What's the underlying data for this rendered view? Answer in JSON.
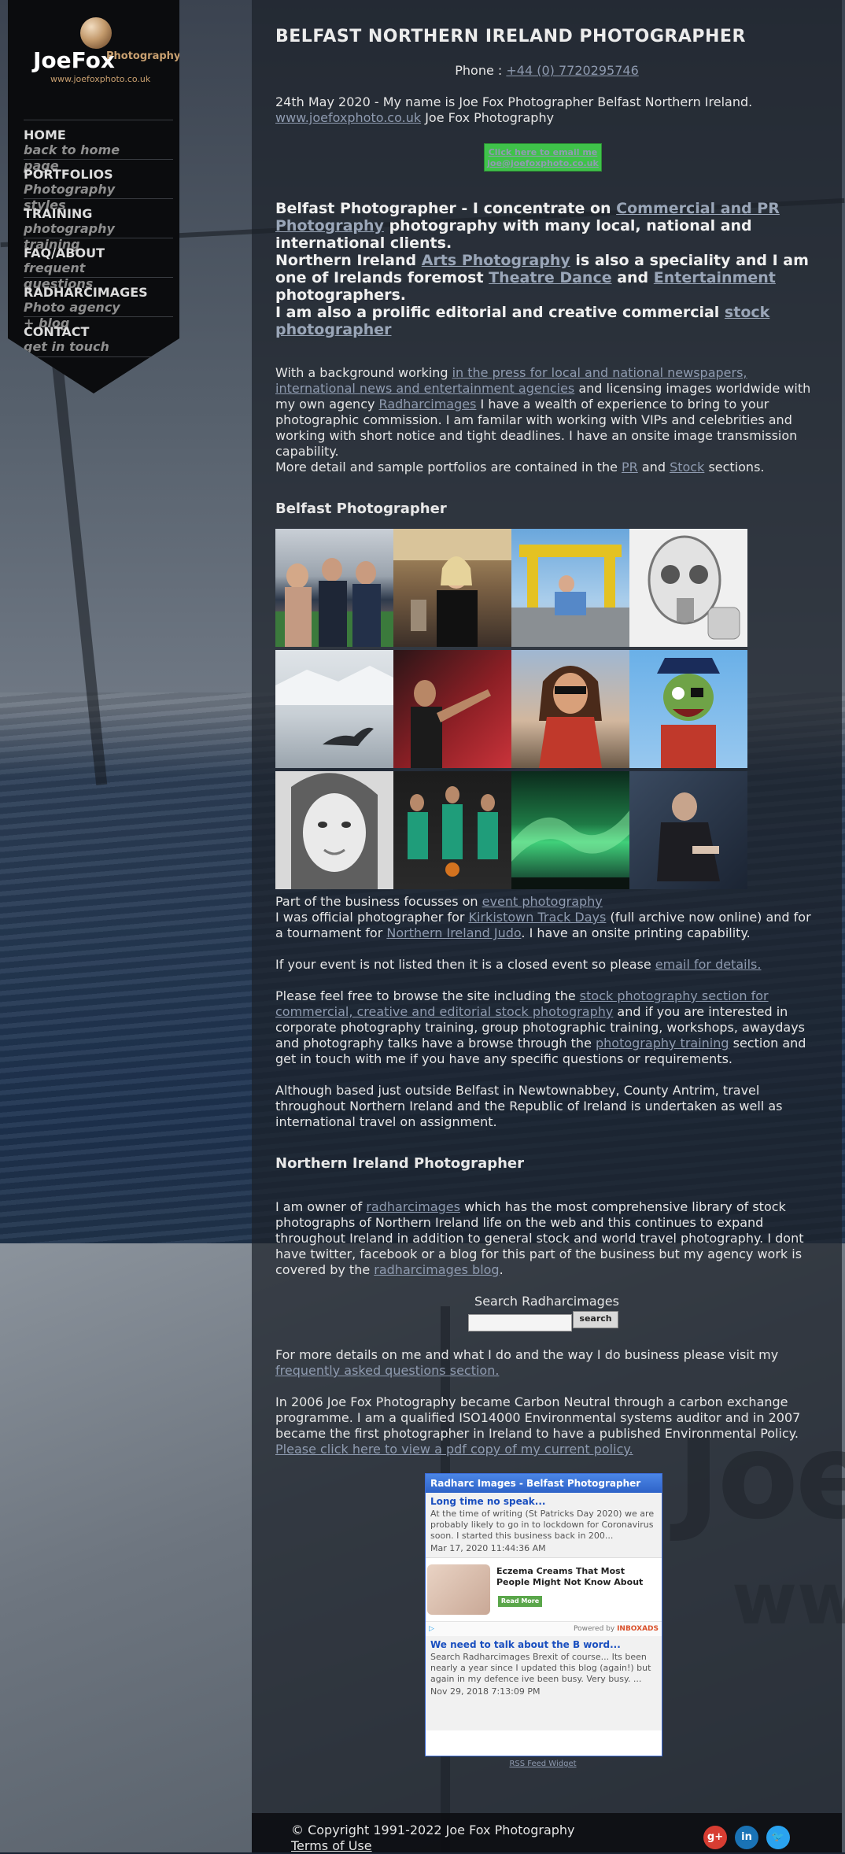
{
  "brand": {
    "logo_name": "JoeFox",
    "logo_sub": "Photography",
    "logo_url": "www.joefoxphoto.co.uk"
  },
  "nav": [
    {
      "label": "HOME",
      "sub": "back to home page"
    },
    {
      "label": "PORTFOLIOS",
      "sub": "Photography styles"
    },
    {
      "label": "TRAINING",
      "sub": "photography training"
    },
    {
      "label": "FAQ/ABOUT",
      "sub": "frequent questions"
    },
    {
      "label": "RADHARCIMAGES",
      "sub": "Photo agency + blog"
    },
    {
      "label": "CONTACT",
      "sub": "get in touch"
    }
  ],
  "header": {
    "title": "BELFAST NORTHERN IRELAND PHOTOGRAPHER",
    "phone_label": "Phone : ",
    "phone_number": "+44 (0) 7720295746"
  },
  "intro": {
    "date_text": "24th May 2020 - My name is Joe Fox Photographer Belfast Northern Ireland.",
    "site_link": "www.joefoxphoto.co.uk",
    "site_suffix": " Joe Fox Photography",
    "email_button_line1": "Click here to email me",
    "email_button_line2": "joe@joefoxphoto.co.uk"
  },
  "highlight": {
    "t1": "Belfast Photographer - I concentrate on ",
    "l1": "Commercial and PR Photography",
    "t2": " photography with many local, national and international clients.",
    "t3": "Northern Ireland ",
    "l2": "Arts Photography",
    "t4": " is also a speciality and I am one of Irelands foremost ",
    "l3": "Theatre Dance",
    "t5": " and ",
    "l4": "Entertainment",
    "t6": " photographers.",
    "t7": "I am also a prolific editorial and creative commercial ",
    "l5": "stock photographer"
  },
  "background_para": {
    "t1": "With a background working ",
    "l1": "in the press for local and national newspapers, international news and entertainment agencies",
    "t2": " and licensing images worldwide with my own agency ",
    "l2": "Radharcimages",
    "t3": " I have a wealth of experience to bring to your photographic commission. I am familar with working with VIPs and celebrities and working with short notice and tight deadlines. I have an onsite image transmission capability.",
    "t4": "More detail and sample portfolios are contained in the ",
    "l3": "PR",
    "t5": " and ",
    "l4": "Stock",
    "t6": " sections."
  },
  "gallery": {
    "heading": "Belfast Photographer"
  },
  "events": {
    "t1": "Part of the business focusses on ",
    "l1": "event photography",
    "t2": "I was official photographer for ",
    "l2": "Kirkistown Track Days",
    "t3": " (full archive now online) and for a tournament for ",
    "l3": "Northern Ireland Judo",
    "t4": ". I have an onsite printing capability.",
    "t5": "If your event is not listed then it is a closed event so please ",
    "l4": "email for details.",
    "t6": "Please feel free to browse the site including the ",
    "l5": "stock photography section for commercial, creative and editorial stock photography",
    "t7": " and if you are interested in corporate photography training, group photographic training, workshops, awaydays and photography talks have a browse through the ",
    "l6": "photography training",
    "t8": " section and get in touch with me if you have any specific questions or requirements.",
    "t9": "Although based just outside Belfast in Newtownabbey, County Antrim, travel throughout Northern Ireland and the Republic of Ireland is undertaken as well as international travel on assignment."
  },
  "ni": {
    "heading": "Northern Ireland Photographer",
    "t1": "I am owner of ",
    "l1": "radharcimages",
    "t2": " which has the most comprehensive library of stock photographs of Northern Ireland life on the web and this continues to expand throughout Ireland in addition to general stock and world travel photography. I dont have twitter, facebook or a blog for this part of the business but my agency work is covered by the ",
    "l2": "radharcimages blog",
    "t3": "."
  },
  "search": {
    "title": "Search Radharcimages",
    "button": "search"
  },
  "faq": {
    "t1": "For more details on me and what I do and the way I do business please visit my ",
    "l1": "frequently asked questions section."
  },
  "carbon": {
    "t1": "In 2006 Joe Fox Photography became Carbon Neutral through a carbon exchange programme. I am a qualified ISO14000 Environmental systems auditor and in 2007 became the first photographer in Ireland to have a published Environmental Policy. ",
    "l1": "Please click here to view a pdf copy of my current policy."
  },
  "widget": {
    "title": "Radharc Images - Belfast Photographer",
    "post1_title": "Long time no speak...",
    "post1_text": "At the time of writing (St Patricks Day 2020) we are probably likely to go in to lockdown for Coronavirus soon. I started this business back in 200...",
    "post1_date": "Mar 17, 2020 11:44:36 AM",
    "ad_text": "Eczema Creams That Most People Might Not Know About",
    "ad_button": "Read More",
    "powered": "Powered by",
    "powered_brand": "INBOXADS",
    "post2_title": "We need to talk about the B word...",
    "post2_text": "Search Radharcimages Brexit of course... Its been nearly a year since I updated this blog (again!) but again in my defence ive been busy. Very busy. ...",
    "post2_date": "Nov 29, 2018 7:13:09 PM",
    "rss_link": "RSS Feed Widget"
  },
  "footer": {
    "copyright": "© Copyright 1991-2022 Joe Fox Photography",
    "terms": "Terms of Use",
    "social": [
      {
        "name": "google-plus-icon",
        "glyph": "g+",
        "color": "#d73d32"
      },
      {
        "name": "linkedin-icon",
        "glyph": "in",
        "color": "#1a73b5"
      },
      {
        "name": "twitter-icon",
        "glyph": "🐦",
        "color": "#2aa3ef"
      }
    ]
  }
}
